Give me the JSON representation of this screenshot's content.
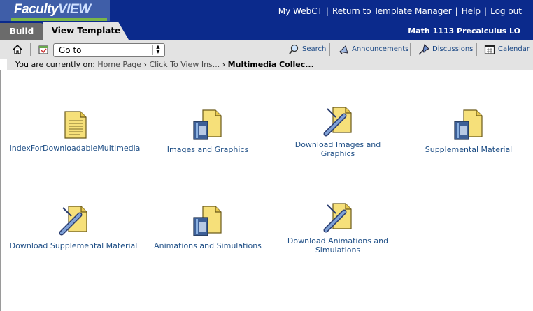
{
  "header": {
    "logo_faculty": "Faculty",
    "logo_view": "VIEW",
    "links": [
      "My WebCT",
      "Return to Template Manager",
      "Help",
      "Log out"
    ],
    "course_title": "Math 1113 Precalculus LO",
    "tabs": [
      "Build",
      "View Template"
    ]
  },
  "toolbar": {
    "goto_value": "Go to",
    "search": "Search",
    "announcements": "Announcements",
    "discussions": "Discussions",
    "calendar": "Calendar"
  },
  "breadcrumb": {
    "prefix": "You are currently on:",
    "items": [
      "Home Page",
      "Click To View Ins...",
      "Multimedia Collec..."
    ]
  },
  "items": [
    {
      "label": "IndexForDownloadableMultimedia",
      "icon": "document-icon"
    },
    {
      "label": "Images and Graphics",
      "icon": "media-folder-icon"
    },
    {
      "label": "Download Images and Graphics",
      "icon": "download-folder-icon"
    },
    {
      "label": "Supplemental Material",
      "icon": "media-folder-icon"
    },
    {
      "label": "Download Supplemental Material",
      "icon": "download-folder-icon"
    },
    {
      "label": "Animations and Simulations",
      "icon": "media-folder-icon"
    },
    {
      "label": "Download Animations and Simulations",
      "icon": "download-folder-icon"
    }
  ],
  "colors": {
    "header_bg": "#0b2a8c",
    "toolbar_bg": "#e3e3e3",
    "link": "#1f4f86",
    "folder": "#f7e27a"
  }
}
